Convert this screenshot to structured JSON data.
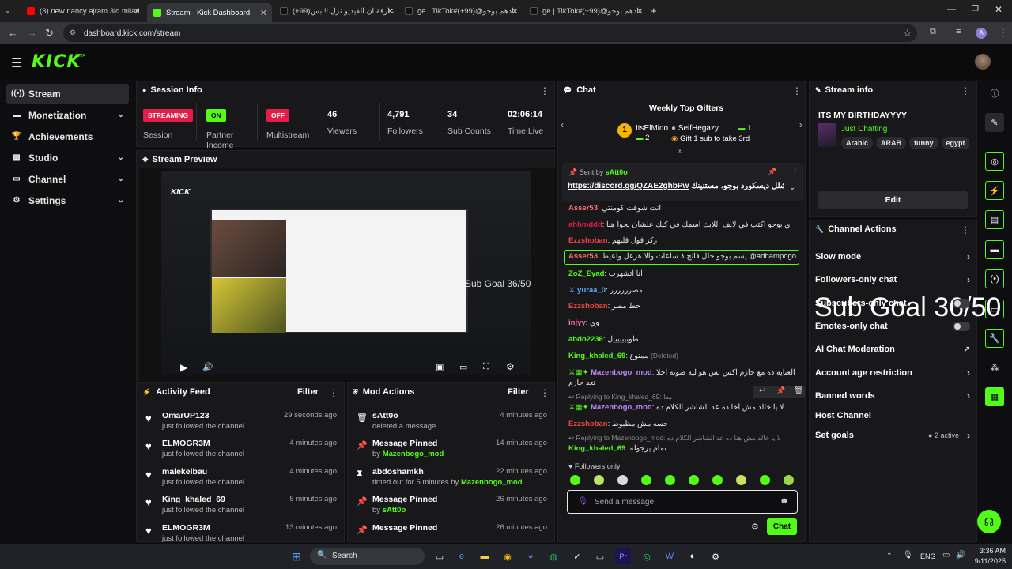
{
  "browser": {
    "tabs": [
      {
        "title": "(3) new nancy ajram 3id milad",
        "active": false
      },
      {
        "title": "Stream - Kick Dashboard",
        "active": true
      },
      {
        "title": "عارفة ان الفيديو نزل !! بس(99+)",
        "active": false
      },
      {
        "title": "ge | TikTok#ادهم بوجو@(99+)",
        "active": false
      },
      {
        "title": "ge | TikTok#ادهم بوجو@(99+)",
        "active": false
      }
    ],
    "url": "dashboard.kick.com/stream"
  },
  "brand": {
    "logo": "KICK",
    "beta": "BETA",
    "accent": "#53fc18"
  },
  "sidebar": {
    "items": [
      {
        "label": "Stream",
        "icon": "broadcast-icon",
        "active": true,
        "expandable": false
      },
      {
        "label": "Monetization",
        "icon": "money-icon",
        "active": false,
        "expandable": true
      },
      {
        "label": "Achievements",
        "icon": "trophy-icon",
        "active": false,
        "expandable": false
      },
      {
        "label": "Studio",
        "icon": "studio-icon",
        "active": false,
        "expandable": true
      },
      {
        "label": "Channel",
        "icon": "channel-icon",
        "active": false,
        "expandable": true
      },
      {
        "label": "Settings",
        "icon": "gear-icon",
        "active": false,
        "expandable": true
      }
    ]
  },
  "session": {
    "title": "Session Info",
    "streaming_badge": "STREAMING",
    "session_label": "Session",
    "partner_badge": "ON",
    "partner_label": "Partner Income",
    "multistream_badge": "OFF",
    "multistream_label": "Multistream",
    "viewers": "46",
    "viewers_label": "Viewers",
    "followers": "4,791",
    "followers_label": "Followers",
    "subs": "34",
    "subs_label": "Sub Counts",
    "time_live": "02:06:14",
    "time_label": "Time Live"
  },
  "preview": {
    "title": "Stream Preview",
    "overlay_logo": "KICK",
    "sub_goal_text": "Sub Goal 36/50"
  },
  "activity": {
    "title": "Activity Feed",
    "filter": "Filter",
    "items": [
      {
        "name": "OmarUP123",
        "action": "just followed the channel",
        "time": "29 seconds ago"
      },
      {
        "name": "ELMOGR3M",
        "action": "just followed the channel",
        "time": "4 minutes ago"
      },
      {
        "name": "malekelbau",
        "action": "just followed the channel",
        "time": "4 minutes ago"
      },
      {
        "name": "King_khaled_69",
        "action": "just followed the channel",
        "time": "5 minutes ago"
      },
      {
        "name": "ELMOGR3M",
        "action": "just followed the channel",
        "time": "13 minutes ago"
      }
    ]
  },
  "mod": {
    "title": "Mod Actions",
    "filter": "Filter",
    "items": [
      {
        "name": "sAtt0o",
        "prefix": "deleted a message",
        "by": "",
        "suffix": "",
        "time": "4 minutes ago",
        "icon": "trash-icon"
      },
      {
        "name": "Message Pinned",
        "prefix": "by ",
        "by": "Mazenbogo_mod",
        "suffix": "",
        "time": "14 minutes ago",
        "icon": "pin-icon"
      },
      {
        "name": "abdoshamkh",
        "prefix": "timed out for 5 minutes by ",
        "by": "Mazenbogo_mod",
        "suffix": "",
        "time": "22 minutes ago",
        "icon": "hourglass-icon"
      },
      {
        "name": "Message Pinned",
        "prefix": "by ",
        "by": "sAtt0o",
        "suffix": "",
        "time": "26 minutes ago",
        "icon": "pin-icon"
      },
      {
        "name": "Message Pinned",
        "prefix": "",
        "by": "",
        "suffix": "",
        "time": "26 minutes ago",
        "icon": "pin-icon"
      }
    ]
  },
  "chat": {
    "title": "Chat",
    "gifters_title": "Weekly Top Gifters",
    "gifter1": {
      "rank": "1",
      "name": "ItsElMido",
      "count": "2"
    },
    "gifter2": {
      "name": "SeifHegazy",
      "count": "1"
    },
    "gifter3": {
      "text": "Gift 1 sub to take 3rd"
    },
    "pinned": {
      "sent_by_label": "Sent by",
      "user": "sAtt0o",
      "link": "https://discord.gg/QZAE2ghbPw",
      "text": "شلل ديسكورد بوجو، مستنينك"
    },
    "messages": [
      {
        "user": "Asser53",
        "color": "#f87171",
        "text": "انت شوفت كومنتي"
      },
      {
        "user": "ahhmddd",
        "color": "#e11d48",
        "text": "ي بوجو اكتب في لايف اللايك اسمك في كيك علشان يجوا هنا"
      },
      {
        "user": "Ezzshoban",
        "color": "#ef4444",
        "text": "ركز قول قلبهم"
      },
      {
        "user": "Asser53",
        "color": "#f87171",
        "text": "يسم بوجو خلل فاتح ٨ ساعات والا هزعل واعيط @adhampogo"
      },
      {
        "user": "ZoZ_Eyad",
        "color": "#53fc18",
        "text": "انا اتشهرت"
      },
      {
        "user": "yuraa_0",
        "color": "#60a5fa",
        "text": "مصرررررر"
      },
      {
        "user": "Ezzshoban",
        "color": "#ef4444",
        "text": "حط مصر"
      },
      {
        "user": "injyy",
        "color": "#f472b6",
        "text": "وي"
      },
      {
        "user": "abdo2236",
        "color": "#53fc18",
        "text": "طويييييييل"
      },
      {
        "user": "King_khaled_69",
        "color": "#53fc18",
        "text": "ممنوع",
        "deleted": "(Deleted)"
      },
      {
        "user": "Mazenbogo_mod",
        "color": "#c084fc",
        "text": "العنايه ده مع حازم اكس بس هو ليه صوته احلا تعد حازم"
      },
      {
        "user": "Mazenbogo_mod",
        "color": "#c084fc",
        "text": "لا يا خالد مش أخا ده عد الشاشر الكلام ده",
        "reply": "Replying to King_khaled_69: معا"
      },
      {
        "user": "Ezzshoban",
        "color": "#ef4444",
        "text": "حسه مش مظبوط"
      },
      {
        "user": "King_khaled_69",
        "color": "#53fc18",
        "text": "تمام يرجولة",
        "reply": "Replying to Mazenbogo_mod: لا يا خالد مش هنا ده عد الشاشر الكلام ده"
      }
    ],
    "followers_only": "Followers only",
    "placeholder": "Send a message",
    "send_label": "Chat"
  },
  "stream_info": {
    "title": "Stream info",
    "stream_title": "ITS MY BIRTHDAYYYY",
    "category": "Just Chatting",
    "tags": [
      "Arabic",
      "ARAB",
      "funny",
      "egypt"
    ],
    "edit_label": "Edit"
  },
  "channel_actions": {
    "title": "Channel Actions",
    "items": [
      {
        "label": "Slow mode",
        "control": "chevron"
      },
      {
        "label": "Followers-only chat",
        "control": "chevron"
      },
      {
        "label": "Subscribers-only chat",
        "control": "toggle"
      },
      {
        "label": "Emotes-only chat",
        "control": "toggle"
      },
      {
        "label": "AI Chat Moderation",
        "control": "external"
      },
      {
        "label": "Account age restriction",
        "control": "chevron"
      },
      {
        "label": "Banned words",
        "control": "chevron"
      },
      {
        "label": "Host Channel",
        "control": "none"
      },
      {
        "label": "Set goals",
        "control": "chevron",
        "badge": "2 active"
      }
    ],
    "overlay_text": "Sub Goal 36/50"
  },
  "taskbar": {
    "search": "Search",
    "lang": "ENG",
    "time": "3:36 AM",
    "date": "9/11/2025"
  }
}
